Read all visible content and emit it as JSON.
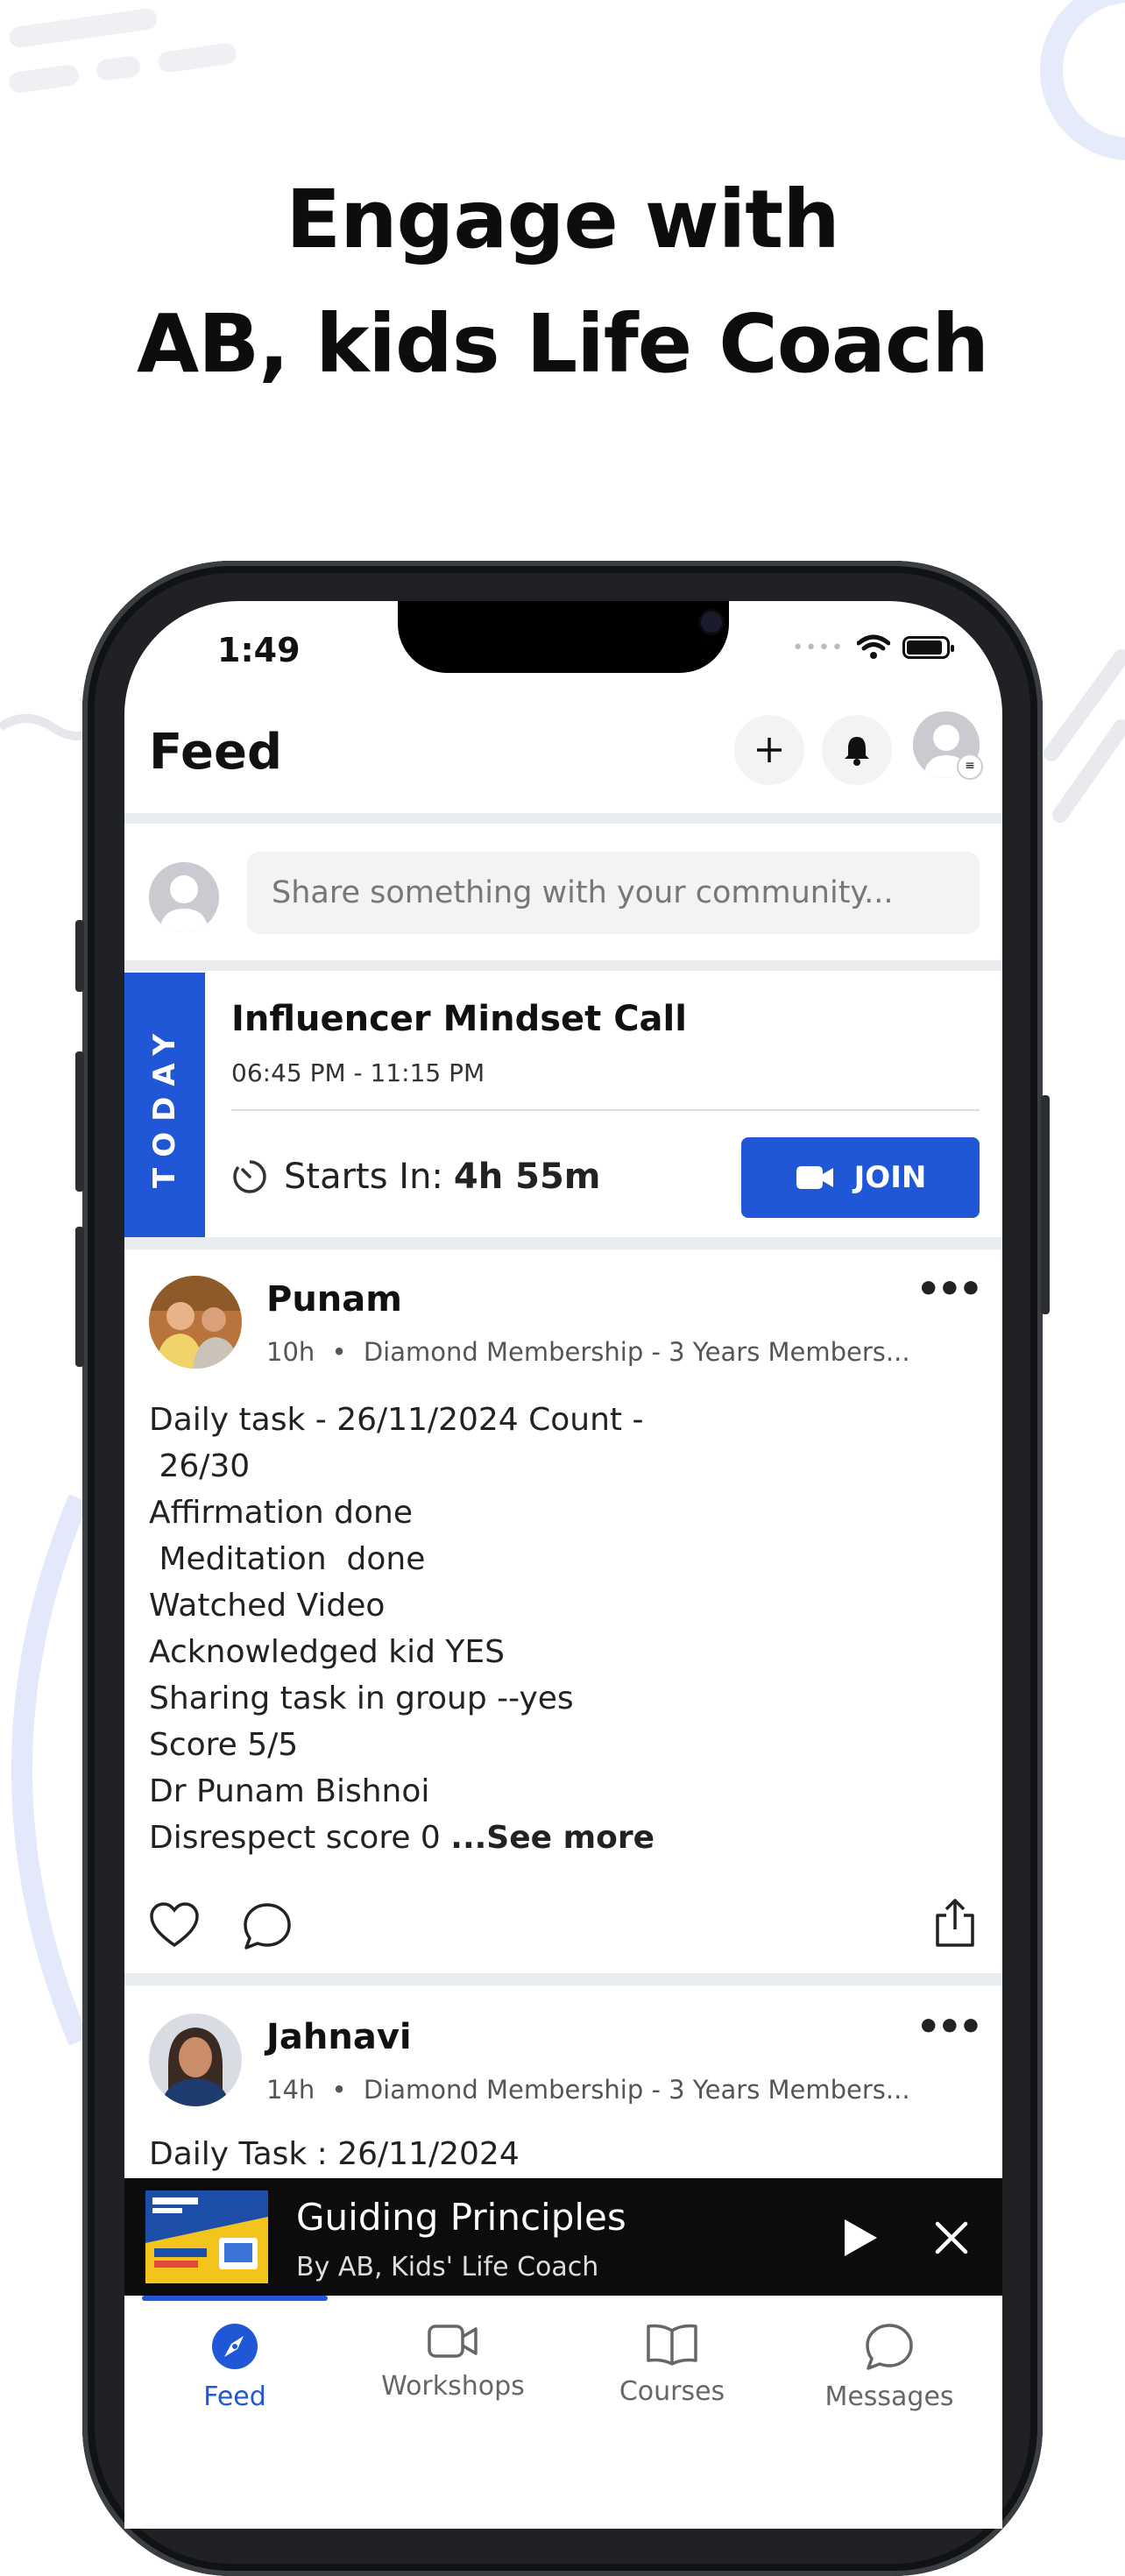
{
  "headline": {
    "line1": "Engage with",
    "line2": "AB, kids Life Coach"
  },
  "status_bar": {
    "time": "1:49"
  },
  "header": {
    "title": "Feed"
  },
  "composer": {
    "placeholder": "Share something with your community..."
  },
  "event": {
    "badge": "TODAY",
    "title": "Influencer Mindset Call",
    "time_range": "06:45 PM - 11:15 PM",
    "starts_label": "Starts In:",
    "starts_value": "4h 55m",
    "join_label": "JOIN"
  },
  "posts": [
    {
      "author": "Punam",
      "age": "10h",
      "membership": "Diamond Membership - 3 Years Members...",
      "lines": [
        "Daily task - 26/11/2024 Count -",
        " 26/30",
        "Affirmation done",
        " Meditation  done",
        "Watched Video",
        "Acknowledged kid YES",
        "Sharing task in group --yes",
        "Score 5/5",
        "Dr Punam Bishnoi",
        "Disrespect score 0"
      ],
      "see_more": "...See more"
    },
    {
      "author": "Jahnavi",
      "age": "14h",
      "membership": "Diamond Membership - 3 Years Members...",
      "lines": [
        "Daily Task : 26/11/2024"
      ]
    }
  ],
  "player": {
    "title": "Guiding Principles",
    "subtitle": "By AB, Kids' Life Coach"
  },
  "tabs": [
    {
      "label": "Feed",
      "icon": "compass-icon",
      "active": true
    },
    {
      "label": "Workshops",
      "icon": "video-camera-icon",
      "active": false
    },
    {
      "label": "Courses",
      "icon": "book-icon",
      "active": false
    },
    {
      "label": "Messages",
      "icon": "chat-bubble-icon",
      "active": false
    }
  ],
  "colors": {
    "accent": "#2057d6",
    "player_bg": "#0c0c0c",
    "background": "#ffffff"
  }
}
